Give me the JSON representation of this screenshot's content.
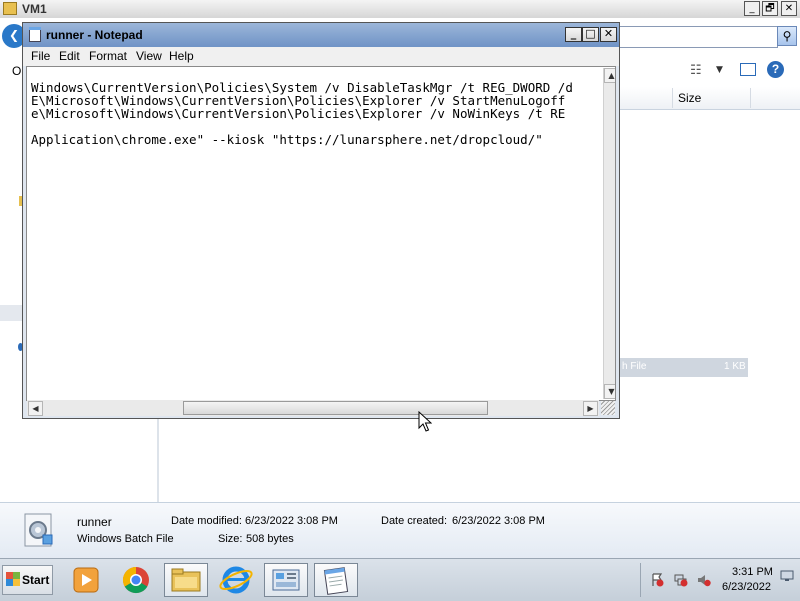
{
  "vm": {
    "title": "VM1",
    "controls": {
      "minimize": "_",
      "restore": "🗗",
      "close": "✕"
    }
  },
  "explorer": {
    "back_glyph": "❮",
    "organize_partial": "Or",
    "search_icon": "⚲",
    "view_icon": "☷",
    "view_dropdown": "▼",
    "help_glyph": "?",
    "columns": {
      "size": "Size"
    },
    "selected_row": {
      "type_partial": "h File",
      "size": "1 KB"
    }
  },
  "details": {
    "name": "runner",
    "type": "Windows Batch File",
    "date_modified_label": "Date modified:",
    "date_modified": "6/23/2022 3:08 PM",
    "size_label": "Size:",
    "size": "508 bytes",
    "date_created_label": "Date created:",
    "date_created": "6/23/2022 3:08 PM"
  },
  "notepad": {
    "title": "runner - Notepad",
    "controls": {
      "minimize": "_",
      "maximize": "□",
      "close": "✕"
    },
    "menu": [
      "File",
      "Edit",
      "Format",
      "View",
      "Help"
    ],
    "content": "Windows\\CurrentVersion\\Policies\\System /v DisableTaskMgr /t REG_DWORD /d\nE\\Microsoft\\Windows\\CurrentVersion\\Policies\\Explorer /v StartMenuLogoff\ne\\Microsoft\\Windows\\CurrentVersion\\Policies\\Explorer /v NoWinKeys /t RE\n\nApplication\\chrome.exe\" --kiosk \"https://lunarsphere.net/dropcloud/\"",
    "scroll": {
      "up": "▲",
      "down": "▼",
      "left": "◀",
      "right": "▶"
    }
  },
  "taskbar": {
    "start_label": "Start",
    "clock_time": "3:31 PM",
    "clock_date": "6/23/2022",
    "colors": {
      "ie": "#1e88e5",
      "chrome_red": "#db4437",
      "chrome_yellow": "#f4b400",
      "chrome_green": "#0f9d58",
      "chrome_blue": "#4285f4"
    }
  }
}
